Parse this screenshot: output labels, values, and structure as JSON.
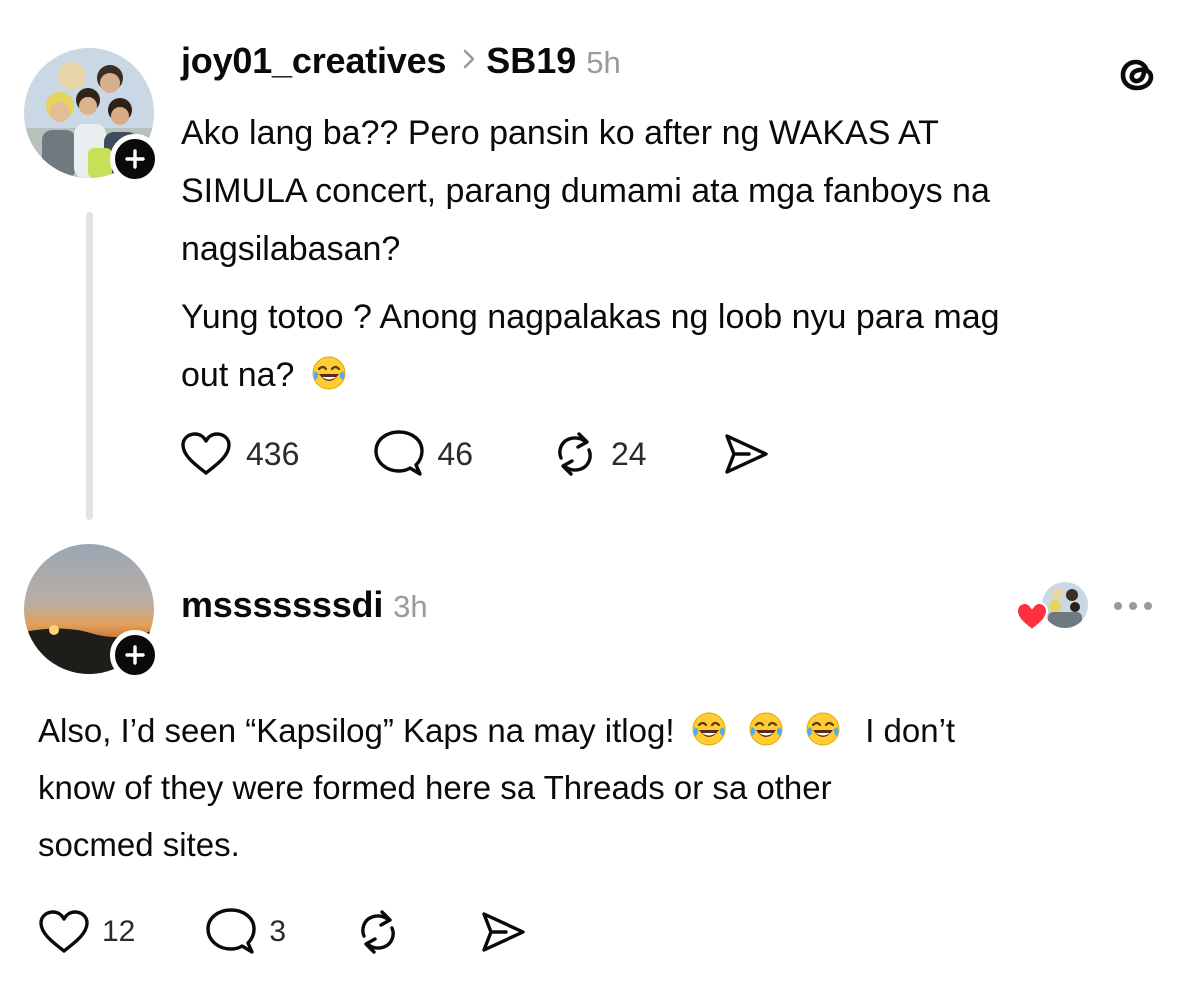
{
  "post": {
    "username": "joy01_creatives",
    "community": "SB19",
    "time": "5h",
    "paragraph1": [
      "Ako lang ba?? Pero pansin ko after ng WAKAS AT",
      "SIMULA concert, parang dumami ata mga fanboys na",
      "nagsilabasan?"
    ],
    "paragraph2_line1": "Yung totoo ? Anong nagpalakas ng loob nyu para mag",
    "paragraph2_line2": "out na?",
    "emoji": "laughing-tears",
    "likes": "436",
    "comments": "46",
    "reposts": "24"
  },
  "reply": {
    "username": "msssssssdi",
    "time": "3h",
    "line1_a": "Also, I’d seen “Kapsilog” Kaps na may itlog!",
    "line1_b": "I don’t",
    "line2": "know of they were formed here sa Threads or sa other",
    "line3": "socmed sites.",
    "emoji_count": 3,
    "likes": "12",
    "comments": "3"
  },
  "colors": {
    "text": "#0a0a0a",
    "muted": "#9a9a9a",
    "thread_line": "#e3e3e3",
    "heart": "#ff3040"
  },
  "icons": [
    "threads-logo-icon",
    "heart-icon",
    "comment-icon",
    "repost-icon",
    "share-icon",
    "more-icon",
    "follow-plus-icon"
  ]
}
